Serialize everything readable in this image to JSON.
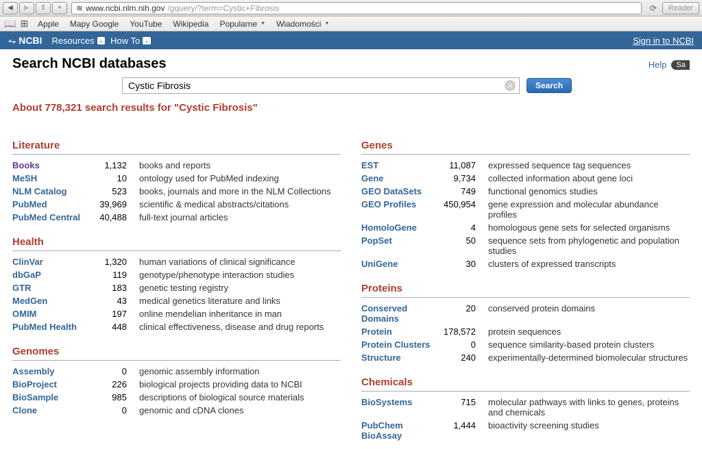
{
  "browser": {
    "url_spinner": "≋",
    "url_host": "www.ncbi.nlm.nih.gov",
    "url_path": "/gquery/?term=Cystic+Fibrosis",
    "reader_label": "Reader"
  },
  "bookmarks": [
    "Apple",
    "Mapy Google",
    "YouTube",
    "Wikipedia",
    "Popularne",
    "Wiadomości"
  ],
  "ncbi_header": {
    "logo": "NCBI",
    "resources": "Resources",
    "howto": "How To",
    "signin": "Sign in to NCBI"
  },
  "page": {
    "title": "Search NCBI databases",
    "help": "Help",
    "save": "Sa",
    "search_value": "Cystic Fibrosis",
    "search_button": "Search",
    "results_summary": "About 778,321 search results for \"Cystic Fibrosis\""
  },
  "sections": {
    "left": [
      {
        "title": "Literature",
        "rows": [
          {
            "name": "Books",
            "count": "1,132",
            "desc": "books and reports",
            "visited": true
          },
          {
            "name": "MeSH",
            "count": "10",
            "desc": "ontology used for PubMed indexing"
          },
          {
            "name": "NLM Catalog",
            "count": "523",
            "desc": "books, journals and more in the NLM Collections"
          },
          {
            "name": "PubMed",
            "count": "39,969",
            "desc": "scientific & medical abstracts/citations"
          },
          {
            "name": "PubMed Central",
            "count": "40,488",
            "desc": "full-text journal articles"
          }
        ]
      },
      {
        "title": "Health",
        "rows": [
          {
            "name": "ClinVar",
            "count": "1,320",
            "desc": "human variations of clinical significance"
          },
          {
            "name": "dbGaP",
            "count": "119",
            "desc": "genotype/phenotype interaction studies"
          },
          {
            "name": "GTR",
            "count": "183",
            "desc": "genetic testing registry"
          },
          {
            "name": "MedGen",
            "count": "43",
            "desc": "medical genetics literature and links"
          },
          {
            "name": "OMIM",
            "count": "197",
            "desc": "online mendelian inheritance in man"
          },
          {
            "name": "PubMed Health",
            "count": "448",
            "desc": "clinical effectiveness, disease and drug reports"
          }
        ]
      },
      {
        "title": "Genomes",
        "rows": [
          {
            "name": "Assembly",
            "count": "0",
            "desc": "genomic assembly information"
          },
          {
            "name": "BioProject",
            "count": "226",
            "desc": "biological projects providing data to NCBI"
          },
          {
            "name": "BioSample",
            "count": "985",
            "desc": "descriptions of biological source materials"
          },
          {
            "name": "Clone",
            "count": "0",
            "desc": "genomic and cDNA clones"
          }
        ]
      }
    ],
    "right": [
      {
        "title": "Genes",
        "rows": [
          {
            "name": "EST",
            "count": "11,087",
            "desc": "expressed sequence tag sequences"
          },
          {
            "name": "Gene",
            "count": "9,734",
            "desc": "collected information about gene loci"
          },
          {
            "name": "GEO DataSets",
            "count": "749",
            "desc": "functional genomics studies"
          },
          {
            "name": "GEO Profiles",
            "count": "450,954",
            "desc": "gene expression and molecular abundance profiles"
          },
          {
            "name": "HomoloGene",
            "count": "4",
            "desc": "homologous gene sets for selected organisms"
          },
          {
            "name": "PopSet",
            "count": "50",
            "desc": "sequence sets from phylogenetic and population studies"
          },
          {
            "name": "UniGene",
            "count": "30",
            "desc": "clusters of expressed transcripts"
          }
        ]
      },
      {
        "title": "Proteins",
        "rows": [
          {
            "name": "Conserved Domains",
            "count": "20",
            "desc": "conserved protein domains"
          },
          {
            "name": "Protein",
            "count": "178,572",
            "desc": "protein sequences"
          },
          {
            "name": "Protein Clusters",
            "count": "0",
            "desc": "sequence similarity-based protein clusters"
          },
          {
            "name": "Structure",
            "count": "240",
            "desc": "experimentally-determined biomolecular structures"
          }
        ]
      },
      {
        "title": "Chemicals",
        "rows": [
          {
            "name": "BioSystems",
            "count": "715",
            "desc": "molecular pathways with links to genes, proteins and chemicals"
          },
          {
            "name": "PubChem BioAssay",
            "count": "1,444",
            "desc": "bioactivity screening studies"
          }
        ]
      }
    ]
  }
}
